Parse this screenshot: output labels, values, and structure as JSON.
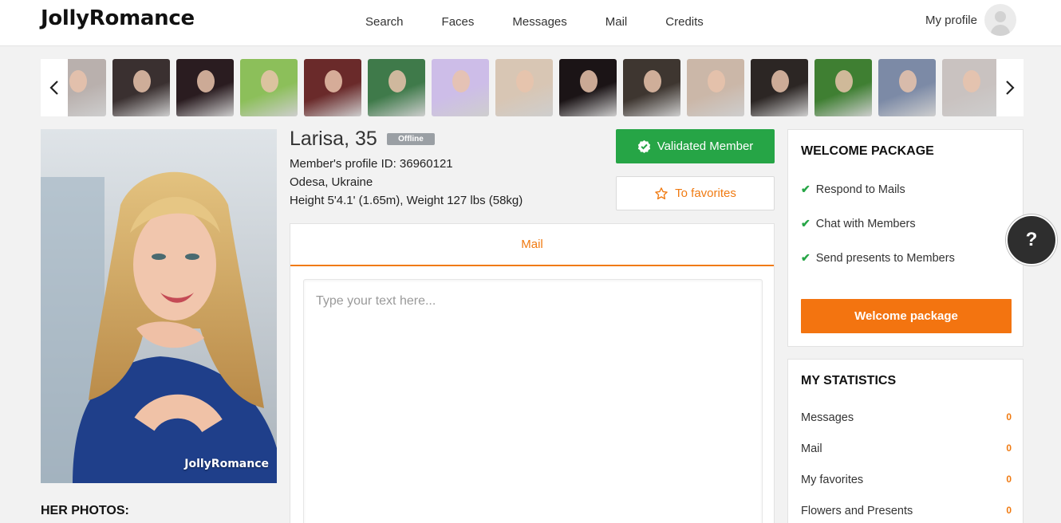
{
  "header": {
    "logo": "JollyRomance",
    "nav": [
      "Search",
      "Faces",
      "Messages",
      "Mail",
      "Credits"
    ],
    "profile_label": "My profile"
  },
  "carousel": {
    "prev_icon": "chevron-left-icon",
    "next_icon": "chevron-right-icon",
    "thumbnail_colors": [
      "#b9b0ad",
      "#3a3030",
      "#2a1c20",
      "#8cbf5a",
      "#6a2a2a",
      "#3f7a4a",
      "#cdbde8",
      "#d8c6b4",
      "#1b1416",
      "#3e3630",
      "#cbb7a8",
      "#2c2624",
      "#3f7f32",
      "#7c8aa6",
      "#c9c2c0"
    ]
  },
  "profile": {
    "name": "Larisa, 35",
    "status": "Offline",
    "profile_id": "Member's profile ID: 36960121",
    "location": "Odesa, Ukraine",
    "measurements": "Height 5'4.1' (1.65m), Weight 127 lbs (58kg)",
    "photo_watermark": "JollyRomance",
    "photos_heading": "HER PHOTOS:"
  },
  "actions": {
    "validated_label": "Validated Member",
    "favorites_label": "To favorites"
  },
  "mail": {
    "tab_label": "Mail",
    "placeholder": "Type your text here..."
  },
  "welcome_package": {
    "title": "WELCOME PACKAGE",
    "features": [
      "Respond to Mails",
      "Chat with Members",
      "Send presents to Members"
    ],
    "button_label": "Welcome package"
  },
  "statistics": {
    "title": "MY STATISTICS",
    "rows": [
      {
        "label": "Messages",
        "count": "0"
      },
      {
        "label": "Mail",
        "count": "0"
      },
      {
        "label": "My favorites",
        "count": "0"
      },
      {
        "label": "Flowers and Presents",
        "count": "0"
      }
    ]
  },
  "help": {
    "label": "?"
  },
  "colors": {
    "accent_orange": "#f37410",
    "validated_green": "#26a546",
    "offline_gray": "#9a9fa4"
  }
}
